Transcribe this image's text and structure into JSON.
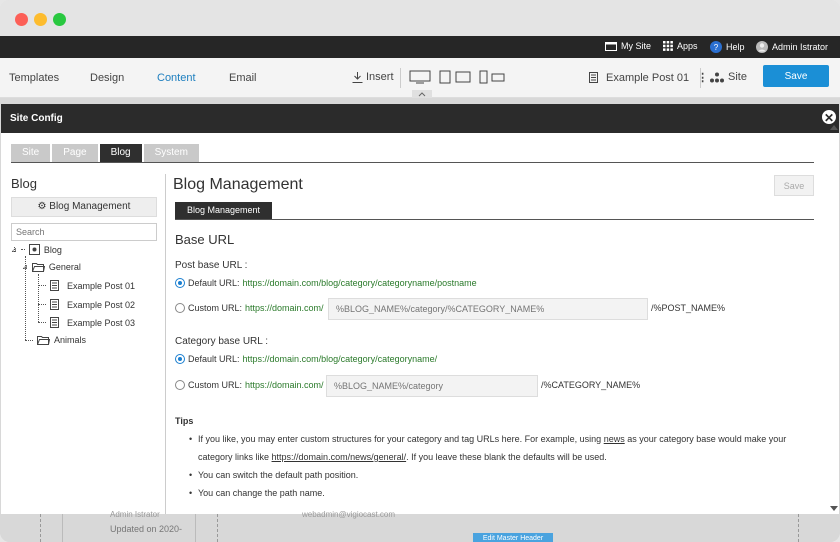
{
  "topbar": {
    "my_site": "My Site",
    "apps": "Apps",
    "help": "Help",
    "user": "Admin Istrator"
  },
  "menubar": {
    "items": [
      "Templates",
      "Design",
      "Content",
      "Email"
    ],
    "active": "Content",
    "insert": "Insert",
    "page_select": "Example Post 01",
    "site": "Site",
    "save": "Save"
  },
  "modal": {
    "title": "Site Config",
    "close": "✕",
    "tabs": [
      "Site",
      "Page",
      "Blog",
      "System"
    ],
    "active_tab": "Blog"
  },
  "sidebar": {
    "title": "Blog",
    "button": "Blog Management",
    "search_placeholder": "Search",
    "tree": {
      "root": "Blog",
      "general": "General",
      "posts": [
        "Example Post 01",
        "Example Post 02",
        "Example Post 03"
      ],
      "animals": "Animals"
    }
  },
  "main": {
    "title": "Blog Management",
    "save": "Save",
    "subtab": "Blog Management",
    "base_url_title": "Base URL",
    "post_base_label": "Post base URL :",
    "post_default_label": "Default URL:",
    "post_default_url": "https://domain.com/blog/category/categoryname/postname",
    "post_custom_label": "Custom URL:",
    "post_custom_prefix": "https://domain.com/",
    "post_custom_placeholder": "%BLOG_NAME%/category/%CATEGORY_NAME%",
    "post_custom_suffix": "/%POST_NAME%",
    "cat_base_label": "Category base URL :",
    "cat_default_label": "Default URL:",
    "cat_default_url": "https://domain.com/blog/category/categoryname/",
    "cat_custom_label": "Custom URL:",
    "cat_custom_prefix": "https://domain.com/",
    "cat_custom_placeholder": "%BLOG_NAME%/category",
    "cat_custom_suffix": "/%CATEGORY_NAME%",
    "tips_title": "Tips",
    "tip1_a": "If you like, you may enter custom structures for your category and tag URLs here. For example, using ",
    "tip1_link1": "news",
    "tip1_b": " as your category base would make your category links like ",
    "tip1_link2": "https://domain.com/news/general/",
    "tip1_c": ". If you leave these blank the defaults will be used.",
    "tip2": "You can switch the default path position.",
    "tip3": "You can change the path name."
  },
  "bottom": {
    "text1": "Updated on 2020-",
    "text2": "Admin Istrator",
    "text3": "webadmin@vigiocast.com",
    "button": "Edit Master Header"
  }
}
